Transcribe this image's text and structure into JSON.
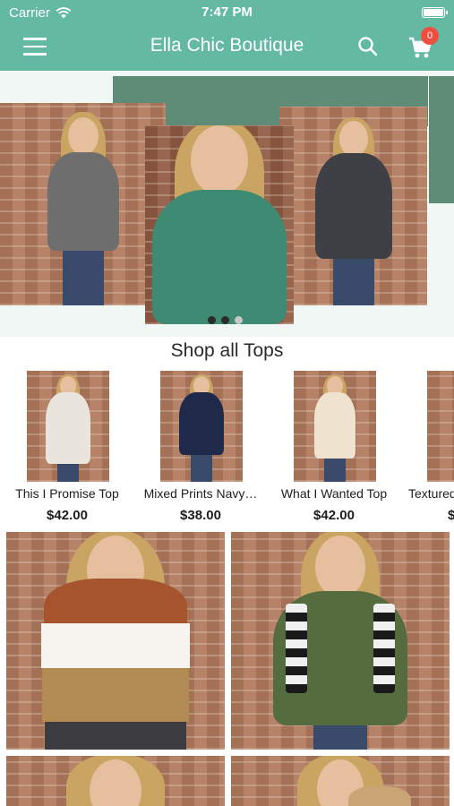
{
  "status_bar": {
    "carrier": "Carrier",
    "time": "7:47 PM"
  },
  "nav": {
    "title": "Ella Chic Boutique",
    "cart_count": "0"
  },
  "colors": {
    "brand": "#63b9a2",
    "banner_accent": "#5f8c77",
    "badge": "#ef4d3f"
  },
  "carousel": {
    "page_count": 3,
    "active_index": 1
  },
  "section": {
    "title": "Shop all Tops"
  },
  "products": [
    {
      "name": "This I Promise Top",
      "price": "$42.00"
    },
    {
      "name": "Mixed Prints Navy…",
      "price": "$38.00"
    },
    {
      "name": "What I Wanted Top",
      "price": "$42.00"
    },
    {
      "name": "Textured",
      "price": "$"
    }
  ]
}
